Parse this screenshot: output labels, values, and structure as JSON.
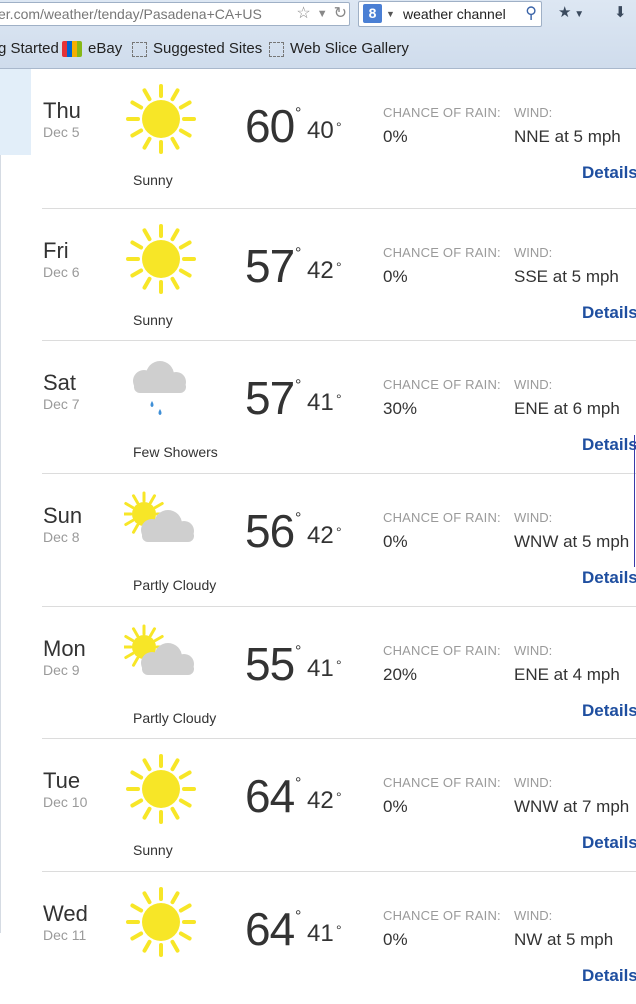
{
  "browser": {
    "url_prefix": "er.com/weather/tenday/Pasadena+CA+U",
    "url_tail": "S",
    "search_engine_badge": "8",
    "search_text": "weather channel",
    "icons": [
      "star-icon",
      "dropdown-arrow-icon",
      "refresh-icon",
      "search-icon",
      "bookmark-star-icon",
      "download-arrow-icon"
    ],
    "favorites": [
      {
        "label": "g Started",
        "icon": "none"
      },
      {
        "label": "eBay",
        "icon": "ebay-icon"
      },
      {
        "label": "Suggested Sites",
        "icon": "dashed-box-icon"
      },
      {
        "label": "Web Slice Gallery",
        "icon": "dashed-box-icon"
      }
    ]
  },
  "labels": {
    "chance_of_rain": "CHANCE OF RAIN:",
    "wind": "WIND:",
    "details": "Details",
    "degree": "°"
  },
  "forecast": [
    {
      "day": "Thu",
      "date": "Dec 5",
      "condition": "Sunny",
      "icon": "sunny",
      "high": "60",
      "low": "40",
      "rain": "0%",
      "wind": "NNE at 5 mph"
    },
    {
      "day": "Fri",
      "date": "Dec 6",
      "condition": "Sunny",
      "icon": "sunny",
      "high": "57",
      "low": "42",
      "rain": "0%",
      "wind": "SSE at 5 mph"
    },
    {
      "day": "Sat",
      "date": "Dec 7",
      "condition": "Few Showers",
      "icon": "showers",
      "high": "57",
      "low": "41",
      "rain": "30%",
      "wind": "ENE at 6 mph"
    },
    {
      "day": "Sun",
      "date": "Dec 8",
      "condition": "Partly Cloudy",
      "icon": "partly-cloudy",
      "high": "56",
      "low": "42",
      "rain": "0%",
      "wind": "WNW at 5 mph"
    },
    {
      "day": "Mon",
      "date": "Dec 9",
      "condition": "Partly Cloudy",
      "icon": "partly-cloudy",
      "high": "55",
      "low": "41",
      "rain": "20%",
      "wind": "ENE at 4 mph"
    },
    {
      "day": "Tue",
      "date": "Dec 10",
      "condition": "Sunny",
      "icon": "sunny",
      "high": "64",
      "low": "42",
      "rain": "0%",
      "wind": "WNW at 7 mph"
    },
    {
      "day": "Wed",
      "date": "Dec 11",
      "condition": "",
      "icon": "sunny",
      "high": "64",
      "low": "41",
      "rain": "0%",
      "wind": "NW at 5 mph"
    }
  ],
  "colors": {
    "sun": "#f7e627",
    "cloud": "#cfcfcf",
    "rain_drop": "#3f8fd6",
    "link": "#1f4fa0",
    "panel": "#e2eef9"
  }
}
